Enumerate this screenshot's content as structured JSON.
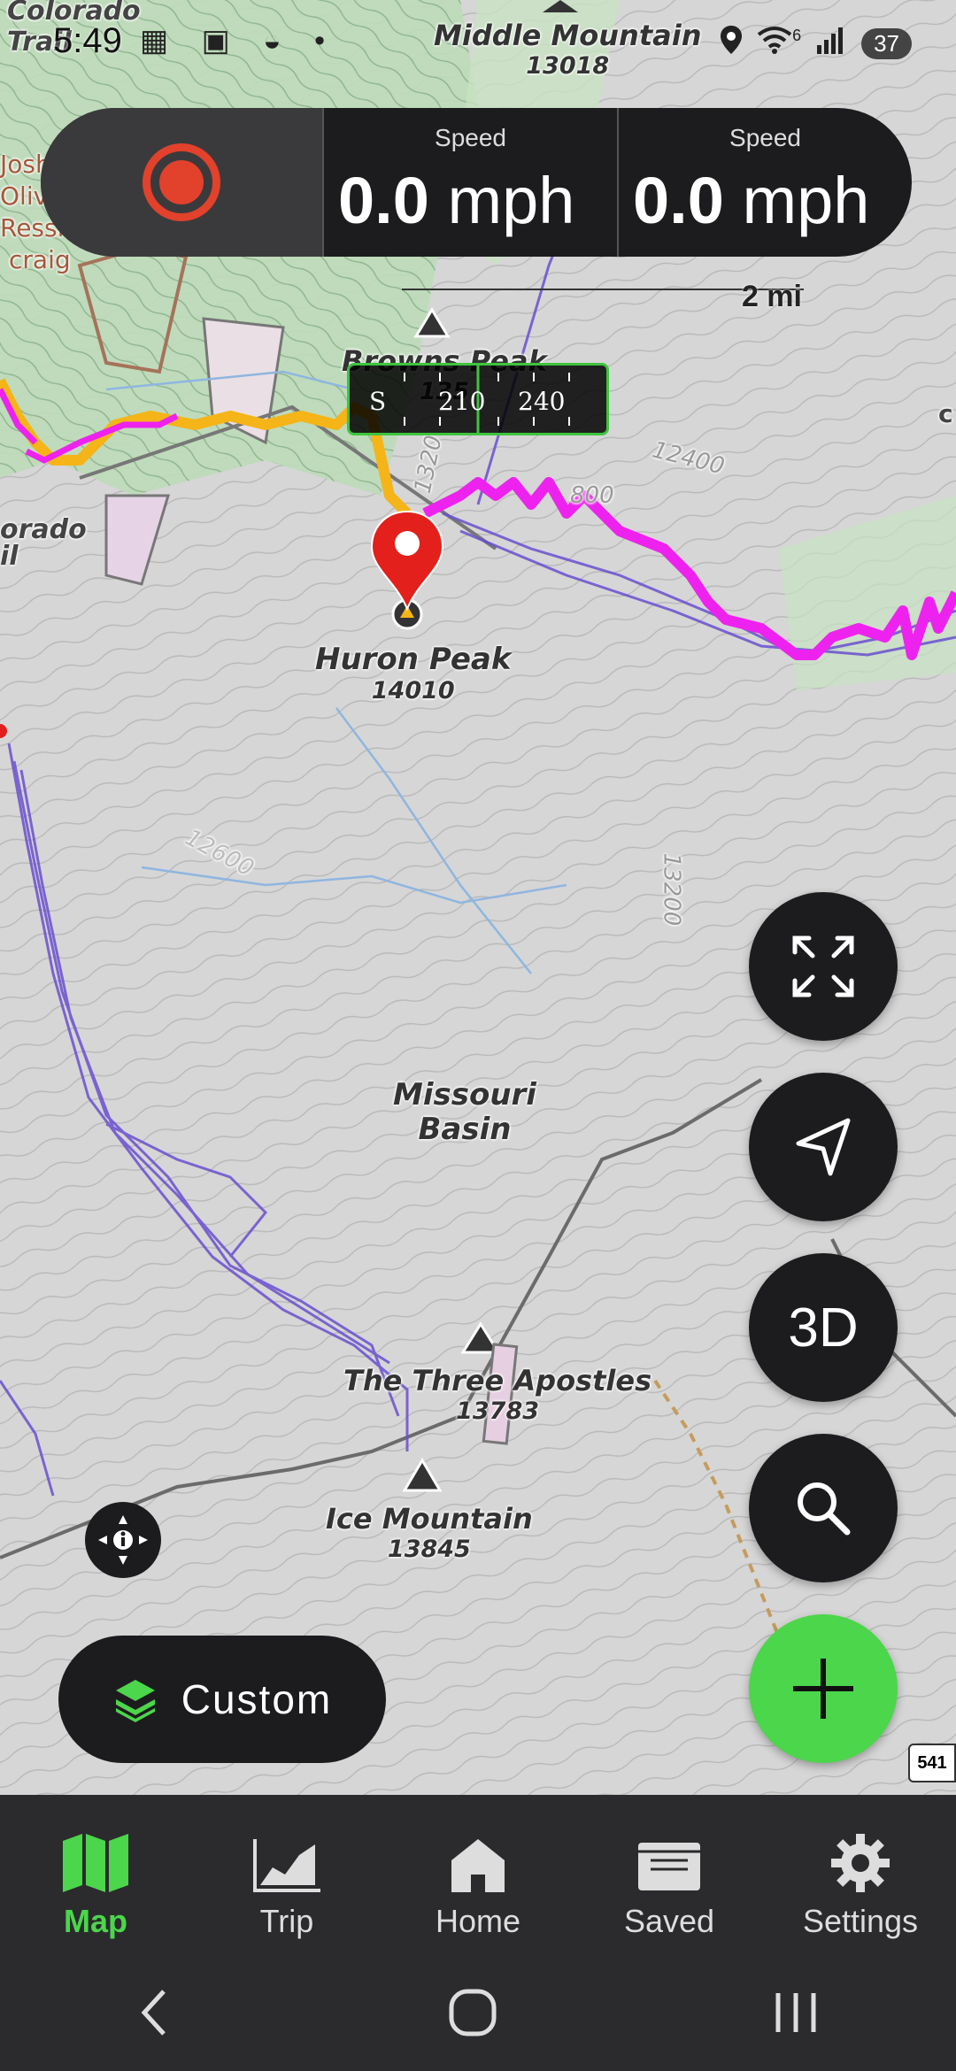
{
  "status_bar": {
    "time": "5:49",
    "left_icons": "▦ ▣ ◒ •",
    "signal_sup": "6",
    "battery": "37"
  },
  "speedbar": {
    "cells": [
      {
        "label": "Speed",
        "value": "0.0",
        "unit": "mph"
      },
      {
        "label": "Speed",
        "value": "0.0",
        "unit": "mph"
      }
    ]
  },
  "scale": {
    "label": "2 mi"
  },
  "compass": {
    "ticks": [
      "S",
      "210",
      "240"
    ]
  },
  "map_labels": {
    "colorado_trail_top": "Colorado\nTrail",
    "middle_mountain": {
      "name": "Middle Mountain",
      "elev": "13018"
    },
    "browns_peak": {
      "name": "Browns Peak",
      "elev": "135"
    },
    "huron_peak": {
      "name": "Huron Peak",
      "elev": "14010"
    },
    "missouri_basin": "Missouri\nBasin",
    "three_apostles": {
      "name": "The Three Apostles",
      "elev": "13783"
    },
    "ice_mountain": {
      "name": "Ice Mountain",
      "elev": "13845"
    },
    "josh": "Josh",
    "oliv": "Oliv",
    "ressl": "Ressl",
    "craig": "craig",
    "orado": "orado",
    "il": "il",
    "contour_12400": "12400",
    "contour_800": "800",
    "contour_13200": "13200",
    "contour_13205": "1320",
    "contour_12600": "12600",
    "edge_c": "c"
  },
  "fabs": {
    "three_d": "3D"
  },
  "layer_button": {
    "label": "Custom"
  },
  "road_badge": "541",
  "bottom_nav": [
    {
      "label": "Map",
      "icon": "map-icon",
      "active": true
    },
    {
      "label": "Trip",
      "icon": "chart-icon",
      "active": false
    },
    {
      "label": "Home",
      "icon": "home-icon",
      "active": false
    },
    {
      "label": "Saved",
      "icon": "folder-icon",
      "active": false
    },
    {
      "label": "Settings",
      "icon": "gear-icon",
      "active": false
    }
  ],
  "colors": {
    "accent_green": "#4bd64b",
    "record_red": "#e2412b",
    "track_magenta": "#ee22ee",
    "track_orange": "#f5b417",
    "trail_purple": "#6a4fd0"
  }
}
